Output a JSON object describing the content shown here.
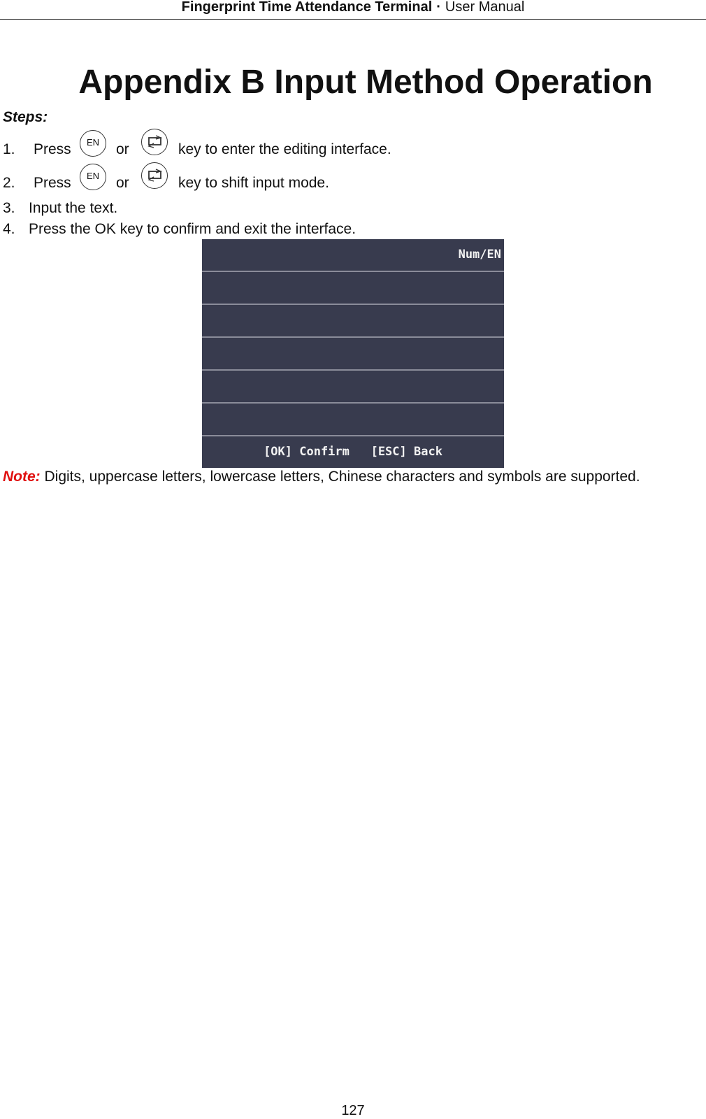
{
  "header": {
    "doc_title": "Fingerprint Time Attendance Terminal",
    "separator": "·",
    "section": "User Manual"
  },
  "title": "Appendix B Input Method Operation",
  "steps_label": "Steps:",
  "steps": [
    {
      "num": "1.",
      "pre": "Press",
      "or": "or",
      "post": "key to enter the editing interface.",
      "key1": "EN",
      "key1_icon": "en-key-icon",
      "key2_icon": "switch-key-icon"
    },
    {
      "num": "2.",
      "pre": "Press",
      "or": "or",
      "post": "key to shift input mode.",
      "key1": "EN",
      "key1_icon": "en-key-icon",
      "key2_icon": "switch-key-icon"
    },
    {
      "num": "3.",
      "text": "Input the text."
    },
    {
      "num": "4.",
      "text": "Press the OK key to confirm and exit the interface."
    }
  ],
  "screen": {
    "mode_indicator": "Num/EN",
    "footer": "[OK] Confirm   [ESC] Back",
    "background": "#383b4e",
    "divider": "#8a8c99"
  },
  "note": {
    "label": "Note:",
    "text": " Digits, uppercase letters, lowercase letters, Chinese characters and symbols are supported.",
    "label_color": "#e01010"
  },
  "page_number": "127"
}
